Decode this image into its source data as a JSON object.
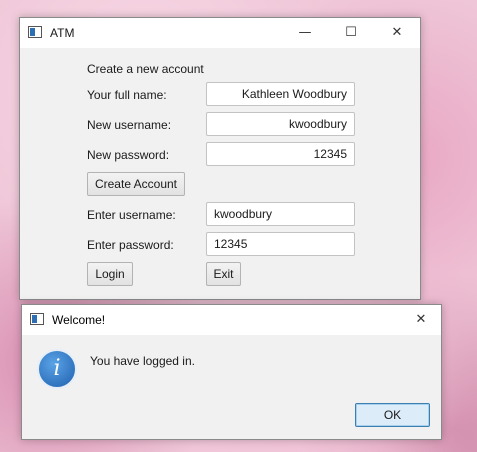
{
  "main_window": {
    "title": "ATM",
    "controls": {
      "minimize": "—",
      "maximize": "☐",
      "close": "✕"
    },
    "heading": "Create a new account",
    "full_name_label": "Your full name:",
    "full_name_value": "Kathleen Woodbury",
    "new_username_label": "New username:",
    "new_username_value": "kwoodbury",
    "new_password_label": "New password:",
    "new_password_value": "12345",
    "create_button": "Create Account",
    "enter_username_label": "Enter username:",
    "enter_username_value": "kwoodbury",
    "enter_password_label": "Enter password:",
    "enter_password_value": "12345",
    "login_button": "Login",
    "exit_button": "Exit"
  },
  "dialog": {
    "title": "Welcome!",
    "close": "✕",
    "message": "You have logged in.",
    "ok_button": "OK",
    "icon": "information-icon"
  }
}
